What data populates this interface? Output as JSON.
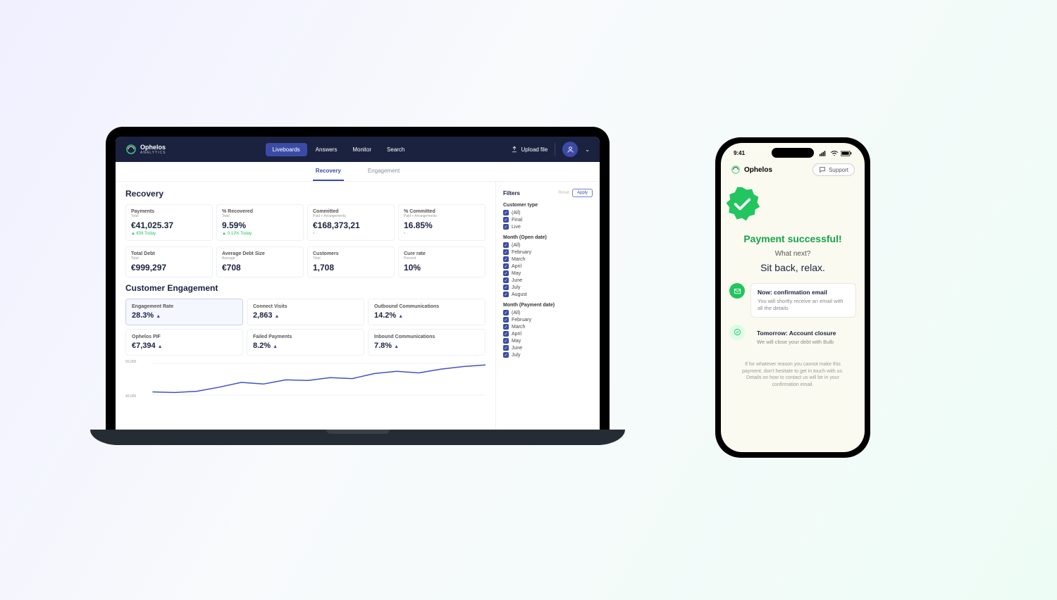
{
  "dashboard": {
    "brand": "Ophelos",
    "brand_sub": "ANALYTICS",
    "nav": [
      "Liveboards",
      "Answers",
      "Monitor",
      "Search"
    ],
    "upload": "Upload file",
    "subnav": [
      "Recovery",
      "Engagement"
    ],
    "recovery_title": "Recovery",
    "kpi_top": [
      {
        "label": "Payments",
        "sub": "Total",
        "val": "€41,025.37",
        "delta": "€56 Today",
        "dir": "up"
      },
      {
        "label": "% Recovered",
        "sub": "Total",
        "val": "9.59%",
        "delta": "0.12% Today",
        "dir": "up"
      },
      {
        "label": "Committed",
        "sub": "Paid + Arrangements",
        "val": "€168,373,21",
        "delta": "",
        "dots": "• -"
      },
      {
        "label": "% Committed",
        "sub": "Paid + Arrangements",
        "val": "16.85%",
        "delta": "",
        "dots": "• -"
      }
    ],
    "kpi_bot": [
      {
        "label": "Total Debt",
        "sub": "Total",
        "val": "€999,297"
      },
      {
        "label": "Average Debt Size",
        "sub": "Average",
        "val": "€708"
      },
      {
        "label": "Customers",
        "sub": "Total",
        "val": "1,708"
      },
      {
        "label": "Cure rate",
        "sub": "Percent",
        "val": "10%"
      }
    ],
    "ce_title": "Customer Engagement",
    "ce": [
      {
        "label": "Engagement Rate",
        "val": "28.3%",
        "hi": true
      },
      {
        "label": "Connect Visits",
        "val": "2,863"
      },
      {
        "label": "Outbound Communications",
        "val": "14.2%"
      },
      {
        "label": "Ophelos PIF",
        "val": "€7,394"
      },
      {
        "label": "Failed Payments",
        "val": "8.2%"
      },
      {
        "label": "Inbound Communications",
        "val": "7.8%"
      }
    ],
    "chart_y": [
      "50,000",
      "40,000"
    ],
    "filters": {
      "title": "Filters",
      "reset": "Reset",
      "apply": "Apply",
      "groups": [
        {
          "title": "Customer type",
          "items": [
            "(All)",
            "Final",
            "Live"
          ]
        },
        {
          "title": "Month (Open date)",
          "items": [
            "(All)",
            "February",
            "March",
            "April",
            "May",
            "June",
            "July",
            "August"
          ]
        },
        {
          "title": "Month (Payment date)",
          "items": [
            "(All)",
            "February",
            "March",
            "April",
            "May",
            "June",
            "July"
          ]
        }
      ]
    }
  },
  "phone": {
    "time": "9:41",
    "brand": "Ophelos",
    "support": "Support",
    "success": "Payment successful!",
    "what_next": "What next?",
    "sit_back": "Sit back, relax.",
    "now_title": "Now: confirmation email",
    "now_body": "You will shortly receive an email with all the details",
    "tom_title": "Tomorrow: Account closure",
    "tom_body": "We will close your debt with Bulb",
    "footer": "If for whatever reason you cannot make this payment, don't hesitate to get in touch with us. Details on how to contact us will be in your confirmation email."
  },
  "chart_data": {
    "type": "line",
    "ylim": [
      40000,
      50000
    ],
    "ylabels": [
      "50,000",
      "40,000"
    ],
    "series": [
      {
        "name": "engagement",
        "values": [
          41000,
          40800,
          41200,
          42500,
          44000,
          43500,
          44800,
          44600,
          45500,
          45200,
          46800,
          47500,
          47000,
          48200,
          49000,
          49500
        ]
      }
    ]
  }
}
